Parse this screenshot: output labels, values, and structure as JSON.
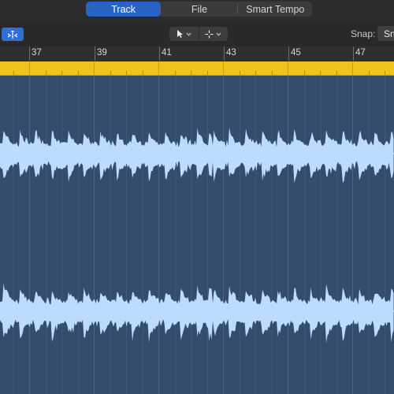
{
  "tabs": [
    {
      "label": "Track",
      "active": true
    },
    {
      "label": "File",
      "active": false
    },
    {
      "label": "Smart Tempo",
      "active": false
    }
  ],
  "toolbar": {
    "catch_icon": "catch-playhead-icon",
    "pointer_tool_icon": "pointer-tool-icon",
    "marquee_tool_icon": "crosshair-tool-icon",
    "snap_label": "Snap:",
    "snap_value": "Sn"
  },
  "ruler": {
    "bars": [
      "37",
      "39",
      "41",
      "43",
      "45",
      "47"
    ]
  },
  "colors": {
    "accent": "#2a63c4",
    "cycle": "#f1c21b",
    "region_bg": "#344d6c",
    "waveform": "#bcdcff"
  }
}
